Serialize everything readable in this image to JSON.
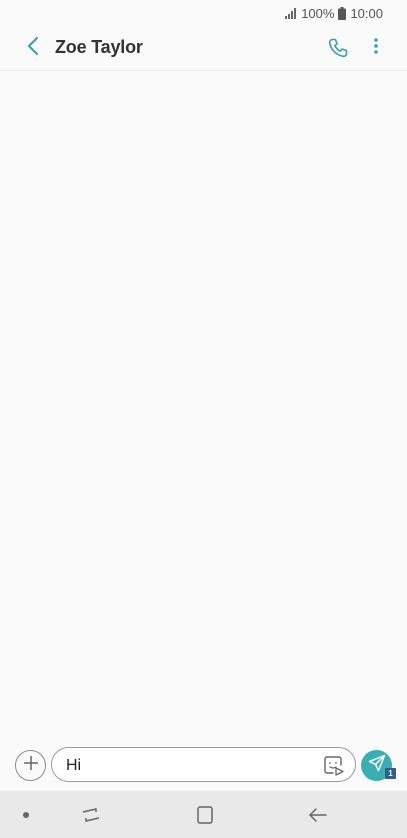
{
  "status_bar": {
    "battery_percent": "100%",
    "time": "10:00",
    "signal_icon": "signal-icon",
    "battery_icon": "battery-icon"
  },
  "header": {
    "title": "Zoe Taylor",
    "back_icon": "chevron-left-icon",
    "call_icon": "phone-icon",
    "more_icon": "more-vertical-icon"
  },
  "composer": {
    "attach_icon": "plus-icon",
    "message_value": "Hi",
    "sticker_icon": "sticker-icon",
    "send_icon": "send-icon",
    "sim_badge": "1"
  },
  "nav_bar": {
    "dot_icon": "dot-icon",
    "recents_icon": "recents-icon",
    "home_icon": "home-icon",
    "back_icon": "back-arrow-icon"
  },
  "colors": {
    "accent": "#3aaeb4",
    "header_icon": "#3a9fb0",
    "background": "#fafafa",
    "nav_bar": "#e9e9e9",
    "sim_badge": "#2f5e8a"
  }
}
